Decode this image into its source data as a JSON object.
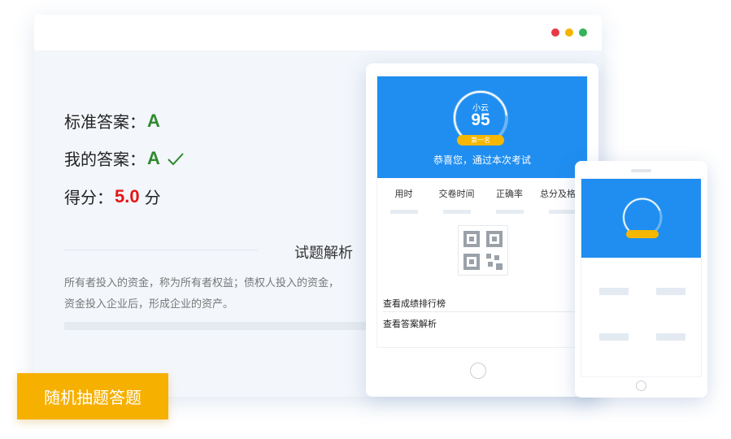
{
  "window": {
    "dots": [
      {
        "name": "close-dot",
        "color": "#e63946"
      },
      {
        "name": "minimize-dot",
        "color": "#f4b400"
      },
      {
        "name": "maximize-dot",
        "color": "#34b35a"
      }
    ]
  },
  "result": {
    "standard_label": "标准答案：",
    "standard_value": "A",
    "my_label": "我的答案：",
    "my_value": "A",
    "my_status_icon": "checkmark-icon",
    "score_label": "得分：",
    "score_value": "5.0",
    "score_unit": "分"
  },
  "analysis": {
    "title": "试题解析",
    "line1": "所有者投入的资金，称为所有者权益；债权人投入的资金，",
    "line2": "资金投入企业后，形成企业的资产。"
  },
  "tablet": {
    "user_name": "小云",
    "score": "95",
    "rank_badge": "第一名",
    "congrats": "恭喜您，通过本次考试",
    "stats": [
      "用时",
      "交卷时间",
      "正确率",
      "总分及格率"
    ],
    "qr_icon": "qr-code-icon",
    "link_ranking": "查看成绩排行榜",
    "link_answers": "查看答案解析"
  },
  "random_quiz": {
    "label": "随机抽题答题"
  },
  "colors": {
    "brand_blue": "#1f8ef0",
    "accent_orange": "#f6b000",
    "correct_green": "#2d8a2d",
    "score_red": "#e31515"
  }
}
